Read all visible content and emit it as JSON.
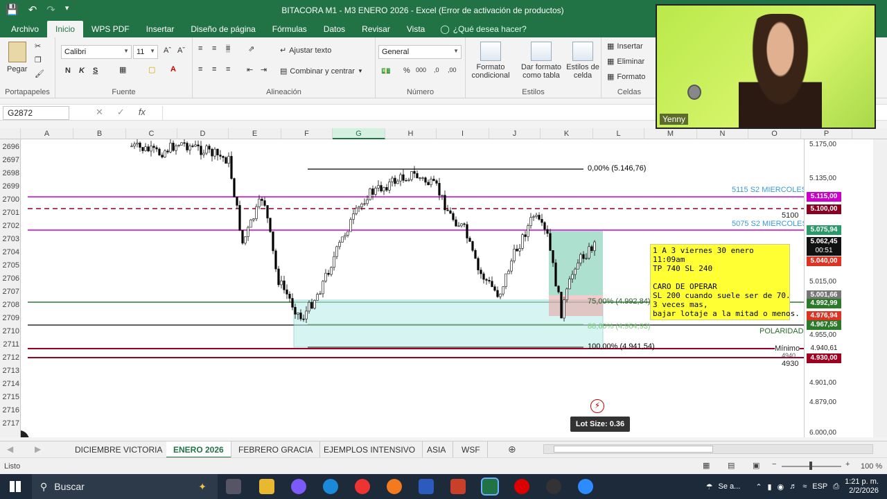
{
  "window": {
    "title": "BITACORA M1 - M3 ENERO 2026 - Excel (Error de activación de productos)"
  },
  "menu": {
    "tabs": [
      "Archivo",
      "Inicio",
      "WPS PDF",
      "Insertar",
      "Diseño de página",
      "Fórmulas",
      "Datos",
      "Revisar",
      "Vista"
    ],
    "active": "Inicio",
    "help": "¿Qué desea hacer?"
  },
  "ribbon": {
    "clipboard": {
      "paste": "Pegar",
      "label": "Portapapeles"
    },
    "font": {
      "name": "Calibri",
      "size": "11",
      "bold": "N",
      "italic": "K",
      "underline": "S",
      "label": "Fuente"
    },
    "alignment": {
      "wrap": "Ajustar texto",
      "merge": "Combinar y centrar",
      "label": "Alineación"
    },
    "number": {
      "format": "General",
      "label": "Número"
    },
    "styles": {
      "cond": "Formato condicional",
      "table": "Dar formato como tabla",
      "cell": "Estilos de celda",
      "label": "Estilos"
    },
    "cells": {
      "insert": "Insertar",
      "delete": "Eliminar",
      "format": "Formato",
      "label": "Celdas"
    }
  },
  "formula": {
    "namebox": "G2872",
    "fx": "fx"
  },
  "columns": [
    "A",
    "B",
    "C",
    "D",
    "E",
    "F",
    "G",
    "H",
    "I",
    "J",
    "K",
    "L",
    "M",
    "N",
    "O",
    "P"
  ],
  "selected_column": "G",
  "rows": [
    "2696",
    "2697",
    "2698",
    "2699",
    "2700",
    "2701",
    "2702",
    "2703",
    "2704",
    "2705",
    "2706",
    "2707",
    "2708",
    "2709",
    "2710",
    "2711",
    "2712",
    "2713",
    "2714",
    "2715",
    "2716",
    "2717"
  ],
  "chart_labels": {
    "fib0": "0,00% (5.146,76)",
    "fib75": "75,00% (4.992,84)",
    "fib88": "88,60% (4.964,93)",
    "fib100": "100,00% (4.941,54)",
    "s2a": "5115 S2 MIERCOLES",
    "s2b": "5075 S2 MIERCOLES",
    "l5100": "5100",
    "polaridad": "POLARIDAD",
    "minimo": "Mínimo",
    "l4930": "4930",
    "l4940": "4940"
  },
  "price_axis": [
    "5.175,00",
    "5.135,00",
    "5.015,00",
    "4.955,00",
    "4.901,00",
    "4.879,00",
    "6.000,00"
  ],
  "price_tags": {
    "p5115": "5.115,00",
    "p5100": "5.100,00",
    "p5075": "5.075,94",
    "p5062": "5.062,45",
    "timer": "00:51",
    "p5040": "5.040,00",
    "p5001": "5.001,66",
    "p4992": "4.992,99",
    "p4976": "4.976,94",
    "p4967": "4.967,55",
    "p4940": "4.940,61",
    "p4930": "4.930,00"
  },
  "note": {
    "lines": [
      "1 A 3 viernes 30 enero",
      "11:09am",
      "TP 740 SL 240",
      "",
      "CARO DE OPERAR",
      "SL 200 cuando suele ser de 70.",
      "3 veces mas,",
      "bajar lotaje a la mitad o menos."
    ]
  },
  "lot_size": "Lot Size: 0.36",
  "sheets": [
    "DICIEMBRE VICTORIA",
    "ENERO 2026",
    "FEBRERO GRACIA",
    "EJEMPLOS INTENSIVO",
    "ASIA",
    "WSF"
  ],
  "active_sheet": "ENERO 2026",
  "status": {
    "ready": "Listo",
    "zoom": "100 %"
  },
  "taskbar": {
    "search": "Buscar",
    "weather": "Se a...",
    "lang": "ESP",
    "time": "1:21 p. m.",
    "date": "2/2/2026"
  },
  "webcam": {
    "name": "Yenny"
  },
  "colors": {
    "excel_green": "#217346",
    "magenta": "#cc00cc",
    "darkred": "#a00020",
    "note_yellow": "#ffff33"
  }
}
